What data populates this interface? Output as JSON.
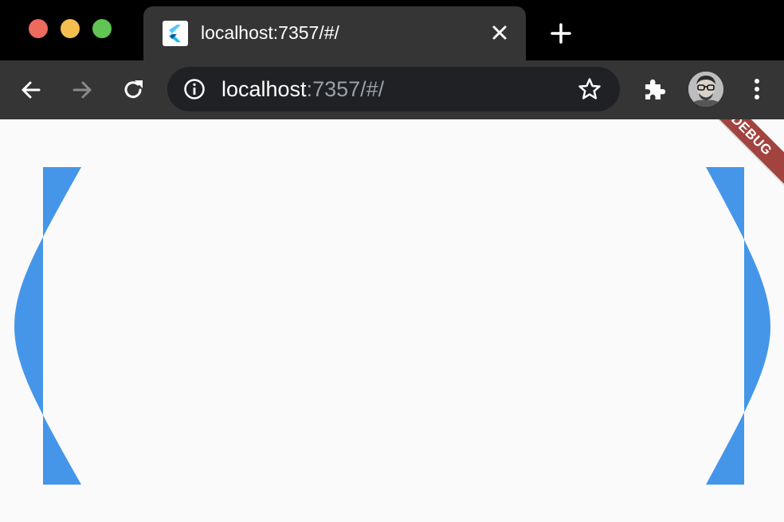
{
  "window": {
    "traffic_lights": [
      "close",
      "minimize",
      "zoom"
    ]
  },
  "tab": {
    "title": "localhost:7357/#/",
    "favicon": "flutter-icon",
    "close_icon": "close-icon"
  },
  "new_tab_icon": "plus-icon",
  "toolbar": {
    "back_icon": "arrow-left-icon",
    "forward_icon": "arrow-right-icon",
    "reload_icon": "reload-icon",
    "site_info_icon": "info-icon",
    "url_host": "localhost",
    "url_rest": ":7357/#/",
    "bookmark_icon": "star-icon",
    "extensions_icon": "puzzle-icon",
    "profile_icon": "avatar",
    "menu_icon": "vertical-dots-icon"
  },
  "debug_banner": "DEBUG",
  "colors": {
    "shape_fill": "#4596e9",
    "page_background": "#fafafa",
    "banner": "#a2433f"
  }
}
